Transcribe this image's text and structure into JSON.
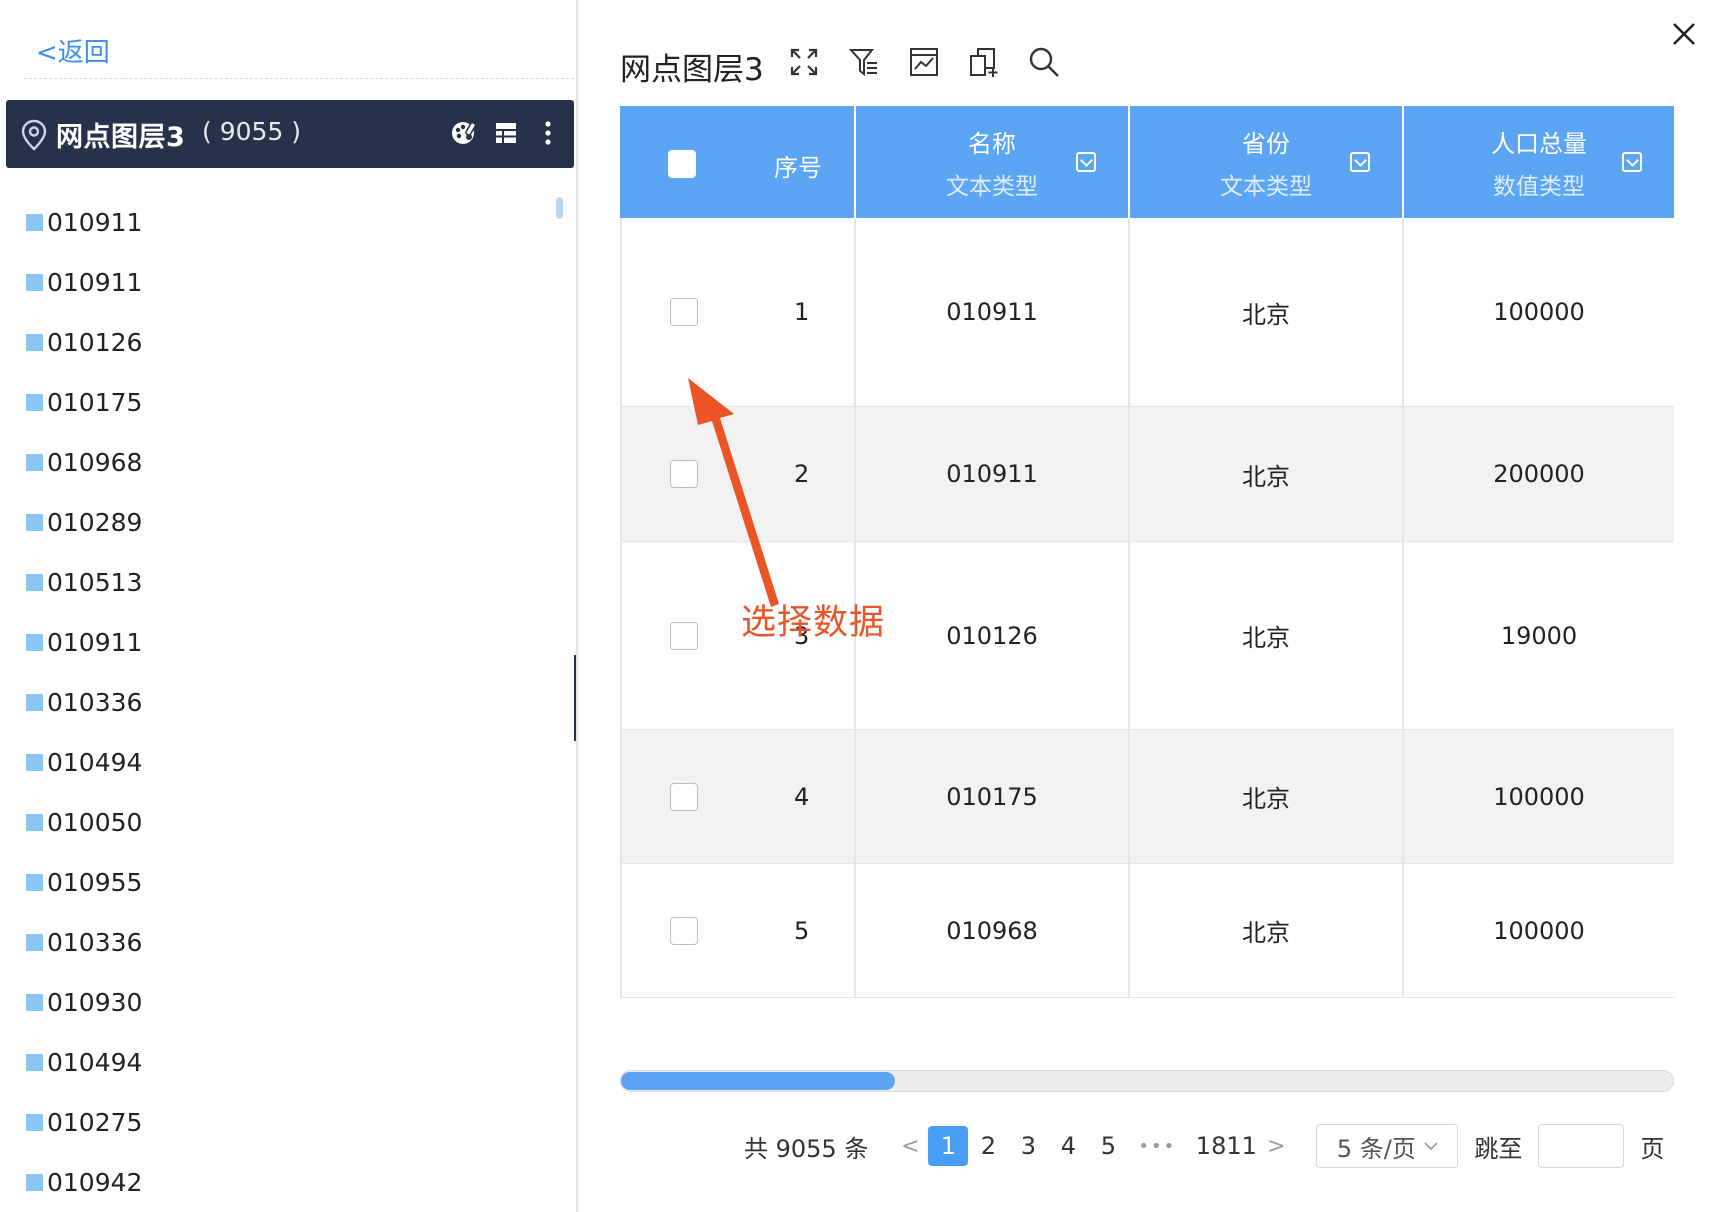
{
  "sidebar": {
    "back_label": "<返回",
    "layer_title": "网点图层3",
    "layer_count": "( 9055 )",
    "items": [
      "010911",
      "010911",
      "010126",
      "010175",
      "010968",
      "010289",
      "010513",
      "010911",
      "010336",
      "010494",
      "010050",
      "010955",
      "010336",
      "010930",
      "010494",
      "010275",
      "010942"
    ]
  },
  "panel": {
    "title": "网点图层3",
    "toolbar": [
      "fullscreen-icon",
      "filter-icon",
      "chart-icon",
      "export-icon",
      "search-icon"
    ],
    "table": {
      "index_header": "序号",
      "columns": [
        {
          "name": "名称",
          "type": "文本类型"
        },
        {
          "name": "省份",
          "type": "文本类型"
        },
        {
          "name": "人口总量",
          "type": "数值类型"
        }
      ],
      "rows": [
        {
          "index": "1",
          "name": "010911",
          "province": "北京",
          "population": "100000"
        },
        {
          "index": "2",
          "name": "010911",
          "province": "北京",
          "population": "200000"
        },
        {
          "index": "3",
          "name": "010126",
          "province": "北京",
          "population": "19000"
        },
        {
          "index": "4",
          "name": "010175",
          "province": "北京",
          "population": "100000"
        },
        {
          "index": "5",
          "name": "010968",
          "province": "北京",
          "population": "100000"
        }
      ],
      "horizontal_scroll_position": 0.26
    },
    "annotation": "选择数据",
    "pagination": {
      "total": "共 9055 条",
      "pages": [
        "1",
        "2",
        "3",
        "4",
        "5"
      ],
      "active_page": "1",
      "ellipsis": "•••",
      "last_page": "1811",
      "page_size": "5 条/页",
      "jump_label": "跳至",
      "page_unit": "页"
    }
  },
  "colors": {
    "accent": "#4a9df5",
    "header_bg": "#5ba5f4",
    "layer_header_bg": "#26324a",
    "annotation": "#eb5427"
  }
}
